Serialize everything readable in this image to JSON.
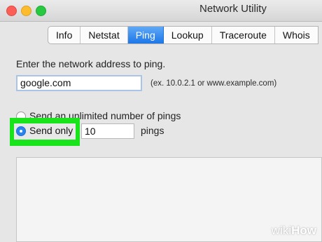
{
  "window": {
    "title": "Network Utility"
  },
  "tabs": [
    {
      "label": "Info"
    },
    {
      "label": "Netstat"
    },
    {
      "label": "Ping",
      "active": true
    },
    {
      "label": "Lookup"
    },
    {
      "label": "Traceroute"
    },
    {
      "label": "Whois"
    }
  ],
  "ping": {
    "prompt": "Enter the network address to ping.",
    "address_value": "google.com",
    "address_hint": "(ex. 10.0.2.1 or www.example.com)",
    "unlimited_label": "Send an unlimited number of pings",
    "send_only_label": "Send only",
    "count_value": "10",
    "count_suffix": "pings"
  },
  "watermark": {
    "brand": "wiki",
    "brand_suffix": "How"
  },
  "colors": {
    "highlight": "#19e41b",
    "accent": "#1c77e8"
  }
}
